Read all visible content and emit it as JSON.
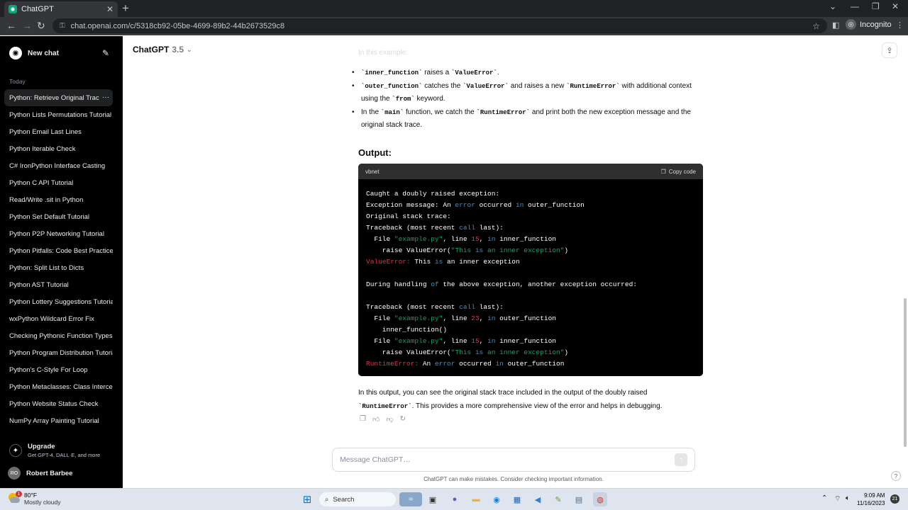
{
  "browser": {
    "tab_title": "ChatGPT",
    "url": "chat.openai.com/c/5318cb92-05be-4699-89b2-44b2673529c8",
    "incognito_label": "Incognito"
  },
  "sidebar": {
    "new_chat_label": "New chat",
    "section_today": "Today",
    "items": [
      {
        "label": "Python: Retrieve Original Trace"
      },
      {
        "label": "Python Lists Permutations Tutorial"
      },
      {
        "label": "Python Email Last Lines"
      },
      {
        "label": "Python Iterable Check"
      },
      {
        "label": "C# IronPython Interface Casting"
      },
      {
        "label": "Python C API Tutorial"
      },
      {
        "label": "Read/Write .sit in Python"
      },
      {
        "label": "Python Set Default Tutorial"
      },
      {
        "label": "Python P2P Networking Tutorial"
      },
      {
        "label": "Python Pitfalls: Code Best Practices"
      },
      {
        "label": "Python: Split List to Dicts"
      },
      {
        "label": "Python AST Tutorial"
      },
      {
        "label": "Python Lottery Suggestions Tutorial"
      },
      {
        "label": "wxPython Wildcard Error Fix"
      },
      {
        "label": "Checking Pythonic Function Types"
      },
      {
        "label": "Python Program Distribution Tutorial"
      },
      {
        "label": "Python's C-Style For Loop"
      },
      {
        "label": "Python Metaclasses: Class Interception"
      },
      {
        "label": "Python Website Status Check"
      },
      {
        "label": "NumPy Array Painting Tutorial"
      }
    ],
    "upgrade_title": "Upgrade",
    "upgrade_subtitle": "Get GPT-4, DALL·E, and more",
    "user_initials": "RO",
    "user_name": "Robert Barbee"
  },
  "header": {
    "model_name": "ChatGPT",
    "model_version": "3.5"
  },
  "message": {
    "faded_line": "In this example:",
    "bullets": [
      {
        "code1": "`inner_function`",
        "text1": " raises a ",
        "code2": "`ValueError`",
        "text2": "."
      },
      {
        "code1": "`outer_function`",
        "text1": " catches the ",
        "code2": "`ValueError`",
        "text2": " and raises a new ",
        "code3": "`RuntimeError`",
        "text3": " with additional context using the ",
        "code4": "`from`",
        "text4": " keyword."
      },
      {
        "text0": "In the ",
        "code1": "`main`",
        "text1": " function, we catch the ",
        "code2": "`RuntimeError`",
        "text2": " and print both the new exception message and the original stack trace."
      }
    ],
    "output_heading": "Output:",
    "code_lang": "vbnet",
    "copy_label": "Copy code",
    "code_lines": [
      "Caught a doubly raised exception:",
      "Exception message: An error occurred in outer_function",
      "Original stack trace:",
      "Traceback (most recent call last):",
      "  File \"example.py\", line 15, in inner_function",
      "    raise ValueError(\"This is an inner exception\")",
      "ValueError: This is an inner exception",
      "",
      "During handling of the above exception, another exception occurred:",
      "",
      "Traceback (most recent call last):",
      "  File \"example.py\", line 23, in outer_function",
      "    inner_function()",
      "  File \"example.py\", line 15, in inner_function",
      "    raise ValueError(\"This is an inner exception\")",
      "RuntimeError: An error occurred in outer_function"
    ],
    "summary_text1": "In this output, you can see the original stack trace included in the output of the doubly raised ",
    "summary_code": "`RuntimeError`",
    "summary_text2": ". This provides a more comprehensive view of the error and helps in debugging."
  },
  "composer": {
    "placeholder": "Message ChatGPT…",
    "disclaimer": "ChatGPT can make mistakes. Consider checking important information."
  },
  "taskbar": {
    "weather_temp": "80°F",
    "weather_desc": "Mostly cloudy",
    "weather_badge": "1",
    "search_label": "Search",
    "time": "9:09 AM",
    "date": "11/16/2023",
    "notification_count": "21"
  }
}
